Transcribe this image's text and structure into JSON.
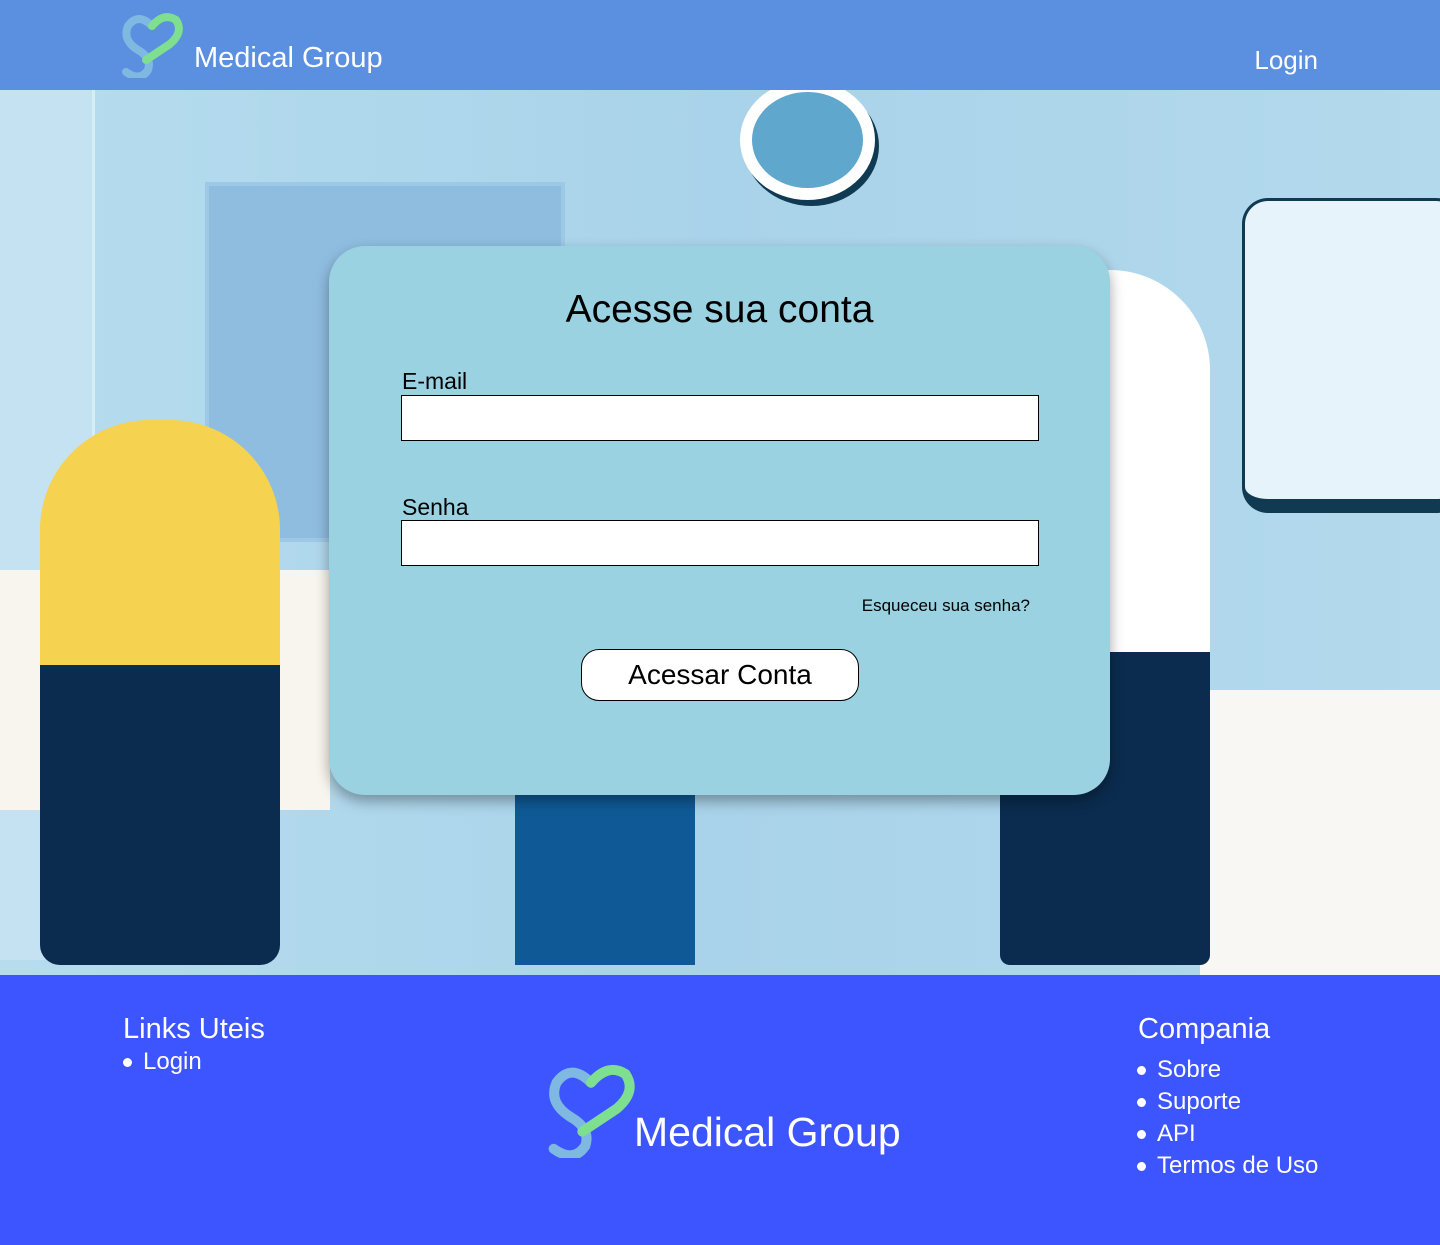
{
  "header": {
    "brand": "Medical Group",
    "login": "Login"
  },
  "form": {
    "title": "Acesse sua conta",
    "email_label": "E-mail",
    "email_value": "",
    "password_label": "Senha",
    "password_value": "",
    "forgot": "Esqueceu sua senha?",
    "submit": "Acessar Conta"
  },
  "footer": {
    "useful_links_title": "Links Uteis",
    "useful_links": [
      "Login"
    ],
    "brand": "Medical Group",
    "company_title": "Compania",
    "company_links": [
      "Sobre",
      "Suporte",
      "API",
      "Termos de Uso"
    ]
  },
  "colors": {
    "header": "#5b8fe0",
    "footer": "#3c55fe",
    "card": "#9ad2e1",
    "logo_blue": "#7fb8e0",
    "logo_green": "#7ddf8f"
  }
}
